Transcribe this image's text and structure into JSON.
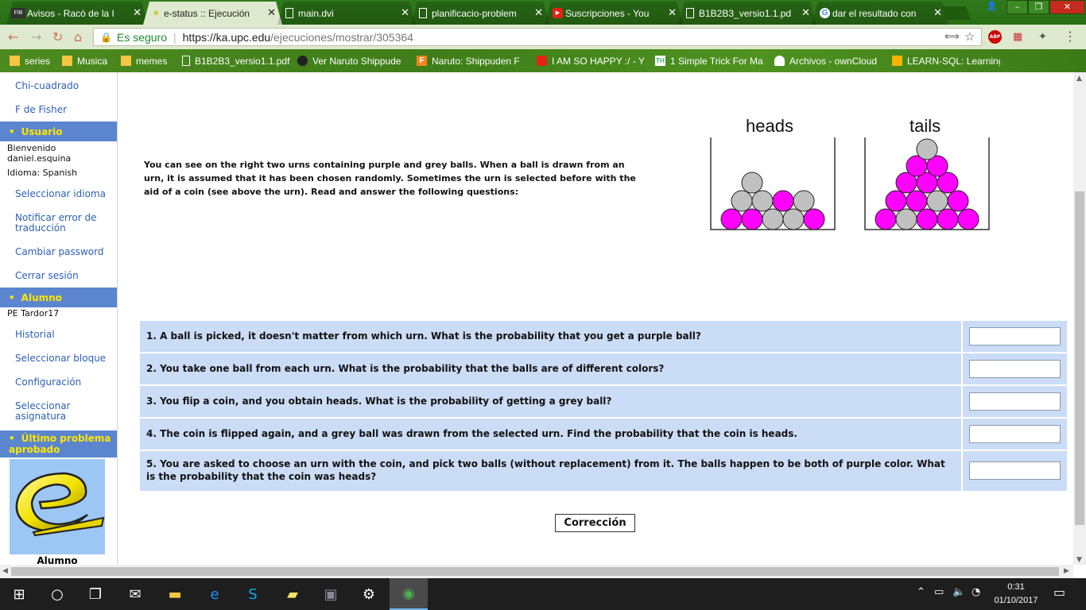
{
  "browser": {
    "tabs": [
      {
        "label": "Avisos - Racó de la I",
        "icon": "fib-icon",
        "active": false
      },
      {
        "label": "e-status :: Ejecución",
        "icon": "estatus-icon",
        "active": true
      },
      {
        "label": "main.dvi",
        "icon": "document-icon",
        "active": false
      },
      {
        "label": "planificacio-problem",
        "icon": "document-icon",
        "active": false
      },
      {
        "label": "Suscripciones - You",
        "icon": "youtube-icon",
        "active": false
      },
      {
        "label": "B1B2B3_versio1.1.pd",
        "icon": "document-icon",
        "active": false
      },
      {
        "label": "dar el resultado con",
        "icon": "google-icon",
        "active": false
      }
    ],
    "tab_close": "✕",
    "address": {
      "secure_label": "Es seguro",
      "url_host": "https://ka.upc.edu",
      "url_path": "/ejecuciones/mostrar/305364"
    },
    "bookmarks": [
      {
        "label": "series",
        "icon": "folder-icon"
      },
      {
        "label": "Musica",
        "icon": "folder-icon"
      },
      {
        "label": "memes",
        "icon": "folder-icon"
      },
      {
        "label": "B1B2B3_versio1.1.pdf",
        "icon": "document-icon"
      },
      {
        "label": "Ver Naruto Shippude",
        "icon": "naruto-icon"
      },
      {
        "label": "Naruto: Shippuden F",
        "icon": "f-icon"
      },
      {
        "label": "I AM SO HAPPY :/ - Y",
        "icon": "youtube-icon"
      },
      {
        "label": "1 Simple Trick For Ma",
        "icon": "th-icon"
      },
      {
        "label": "Archivos - ownCloud",
        "icon": "cloud-icon"
      },
      {
        "label": "LEARN-SQL: Learning",
        "icon": "learnsql-icon"
      }
    ]
  },
  "sidebar": {
    "top_links": [
      "Chi-cuadrado",
      "F de Fisher"
    ],
    "usuario": {
      "heading": "Usuario",
      "bienvenido": "Bienvenido",
      "username": "daniel.esquina",
      "idioma": "Idioma: Spanish",
      "links": [
        "Seleccionar idioma",
        "Notificar error de traducción",
        "Cambiar password",
        "Cerrar sesión"
      ]
    },
    "alumno": {
      "heading": "Alumno",
      "course": "PE Tardor17",
      "links": [
        "Historial",
        "Seleccionar bloque",
        "Configuración",
        "Seleccionar asignatura"
      ]
    },
    "ultimo": {
      "heading": "Último problema aprobado",
      "caption": "Alumno"
    }
  },
  "problem": {
    "intro": "You can see on the right two urns containing purple and grey balls. When a ball is drawn from an urn, it is assumed that it has been chosen randomly. Sometimes the urn is selected before with the aid of a coin (see above the urn). Read and answer the following questions:",
    "urns": [
      {
        "label": "heads",
        "purple": 6,
        "grey": 5
      },
      {
        "label": "tails",
        "purple": 13,
        "grey": 3
      }
    ],
    "colors": {
      "purple": "#ff00ff",
      "grey": "#c0c0c0"
    },
    "questions": [
      {
        "text": "1. A ball is picked, it doesn't matter from which urn. What is the probability that you get a purple ball?",
        "answer": ""
      },
      {
        "text": "2. You take one ball from each urn. What is the probability that the balls are of different colors?",
        "answer": ""
      },
      {
        "text": "3. You flip a coin, and you obtain heads. What is the probability of getting a grey ball?",
        "answer": ""
      },
      {
        "text": "4. The coin is flipped again, and a grey ball was drawn from the selected urn. Find the probability that the coin is heads.",
        "answer": ""
      },
      {
        "text": "5. You are asked to choose an urn with the coin, and pick two balls (without replacement) from it. The balls happen to be both of purple color. What is the probability that the coin was heads?",
        "answer": ""
      }
    ],
    "submit_label": "Corrección"
  },
  "taskbar": {
    "time": "0:31",
    "date": "01/10/2017"
  }
}
